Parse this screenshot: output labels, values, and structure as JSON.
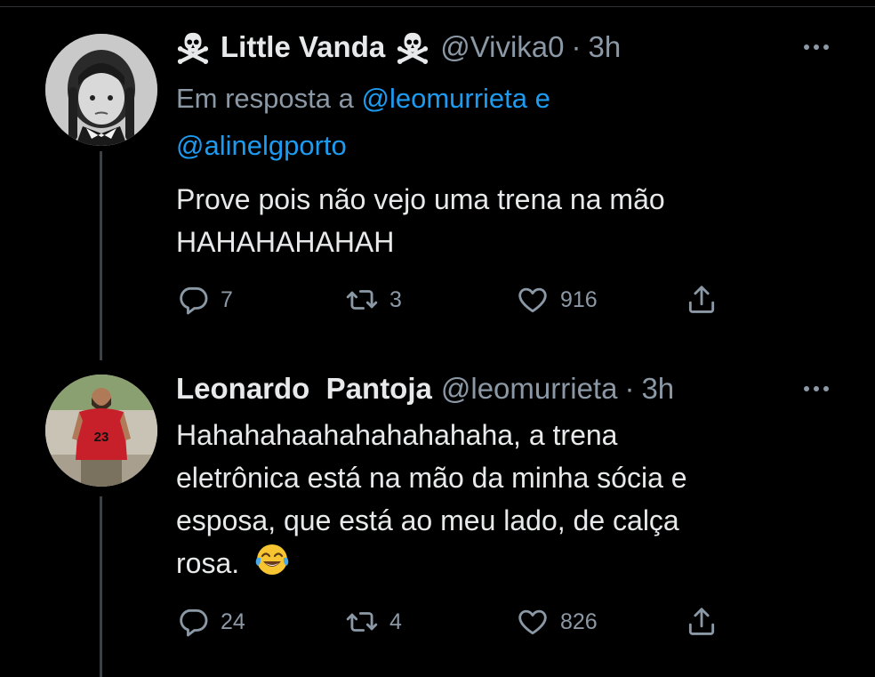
{
  "tweets": [
    {
      "display_name": "Little Vanda",
      "handle": "@Vivika0",
      "sep": "·",
      "time": "3h",
      "reply_prefix": "Em resposta a",
      "reply_mention_1": "@leomurrieta",
      "reply_joiner": "e",
      "reply_mention_2": "@alinelgporto",
      "text_line_1": "Prove pois não vejo uma trena na mão",
      "text_line_2": "HAHAHAHAHAH",
      "replies": "7",
      "retweets": "3",
      "likes": "916"
    },
    {
      "display_name": "Leonardo  Pantoja",
      "handle": "@leomurrieta",
      "sep": "·",
      "time": "3h",
      "text_line_1": "Hahahahaahahahahahaha, a trena",
      "text_line_2": "eletrônica está na mão da minha sócia e",
      "text_line_3": "esposa, que está ao meu lado, de calça",
      "text_line_4": "rosa.",
      "emoji": "😂",
      "replies": "24",
      "retweets": "4",
      "likes": "826"
    }
  ],
  "icons": {
    "name_badge": "skull-crossbones-icon",
    "reply": "reply-icon",
    "retweet": "retweet-icon",
    "like": "heart-icon",
    "share": "share-icon",
    "more": "more-options-icon"
  },
  "colors": {
    "background": "#000000",
    "text": "#e7e9ea",
    "secondary": "#8b98a5",
    "link": "#1d9bf0",
    "thread_line": "#3e4144"
  }
}
